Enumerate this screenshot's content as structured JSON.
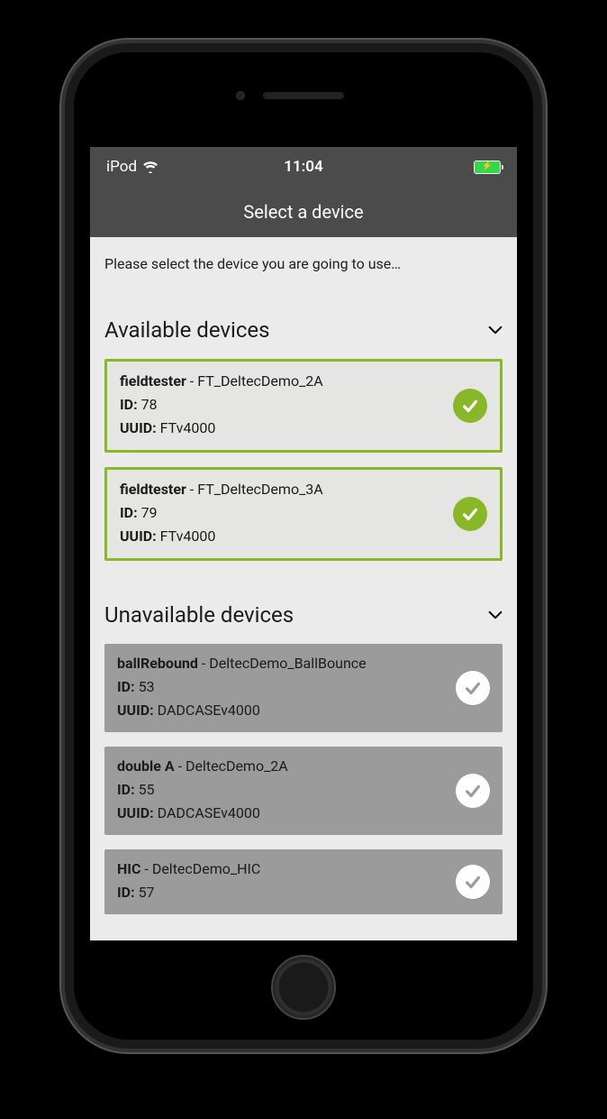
{
  "status_bar": {
    "carrier": "iPod",
    "time": "11:04"
  },
  "header": {
    "title": "Select a device"
  },
  "instruction": "Please select the device you are going to use…",
  "available": {
    "heading": "Available devices",
    "items": [
      {
        "type": "fieldtester",
        "name": "FT_DeltecDemo_2A",
        "id_label": "ID:",
        "id": "78",
        "uuid_label": "UUID:",
        "uuid": "FTv4000"
      },
      {
        "type": "fieldtester",
        "name": "FT_DeltecDemo_3A",
        "id_label": "ID:",
        "id": "79",
        "uuid_label": "UUID:",
        "uuid": "FTv4000"
      }
    ]
  },
  "unavailable": {
    "heading": "Unavailable devices",
    "items": [
      {
        "type": "ballRebound",
        "name": "DeltecDemo_BallBounce",
        "id_label": "ID:",
        "id": "53",
        "uuid_label": "UUID:",
        "uuid": "DADCASEv4000"
      },
      {
        "type": "double A",
        "name": "DeltecDemo_2A",
        "id_label": "ID:",
        "id": "55",
        "uuid_label": "UUID:",
        "uuid": "DADCASEv4000"
      },
      {
        "type": "HIC",
        "name": "DeltecDemo_HIC",
        "id_label": "ID:",
        "id": "57",
        "uuid_label": "UUID:",
        "uuid": ""
      }
    ]
  }
}
